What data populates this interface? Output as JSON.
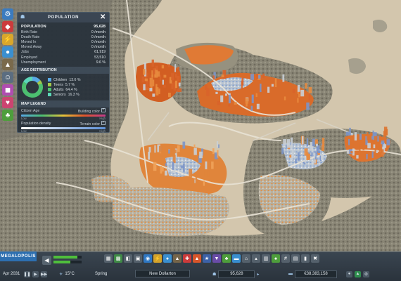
{
  "panel": {
    "title": "POPULATION",
    "summary_label": "POPULATION",
    "summary_value": "95,628",
    "rows": [
      {
        "label": "Birth Rate",
        "value": "0 /month"
      },
      {
        "label": "Death Rate",
        "value": "0 /month"
      },
      {
        "label": "Moved In",
        "value": "0 /month"
      },
      {
        "label": "Moved Away",
        "value": "0 /month"
      },
      {
        "label": "Jobs",
        "value": "61,919"
      },
      {
        "label": "Employed",
        "value": "53,510"
      },
      {
        "label": "Unemployment",
        "value": "9.6 %"
      }
    ],
    "age_title": "AGE DISTRIBUTION",
    "age_items": [
      {
        "label": "Children",
        "value": "13.6 %",
        "color": "#58a9e6",
        "fraction": 0.136
      },
      {
        "label": "Teens",
        "value": "5.7 %",
        "color": "#a3c94a",
        "fraction": 0.057
      },
      {
        "label": "Adults",
        "value": "64.4 %",
        "color": "#4cbf70",
        "fraction": 0.644
      },
      {
        "label": "Seniors",
        "value": "16.3 %",
        "color": "#5cd6b8",
        "fraction": 0.163
      }
    ],
    "legend_title": "MAP LEGEND",
    "legends": [
      {
        "label": "Citizen Age",
        "right": "Building color",
        "low": "Low",
        "high": "High"
      },
      {
        "label": "Population density",
        "right": "Terrain color",
        "low": "Low",
        "high": "High"
      }
    ]
  },
  "bottom": {
    "city_label": "MEGALOPOLIS",
    "date": "Apr 2031",
    "temperature": "15°C",
    "season": "Spring",
    "city_name": "New Dollarton",
    "population": "95,628",
    "money": "€38,383,158",
    "milestone_progress": 0.85,
    "milestone_progress2": 0.6
  },
  "colors": {
    "panel_bg": "#26303a",
    "accent": "#2d6fb0",
    "ui_bar": "#2a333c"
  },
  "icons": [
    "gear-icon",
    "road-icon",
    "zone-icon",
    "water-icon",
    "power-icon",
    "police-icon",
    "fire-icon",
    "health-icon",
    "education-icon",
    "transit-icon",
    "park-icon",
    "landmark-icon"
  ]
}
